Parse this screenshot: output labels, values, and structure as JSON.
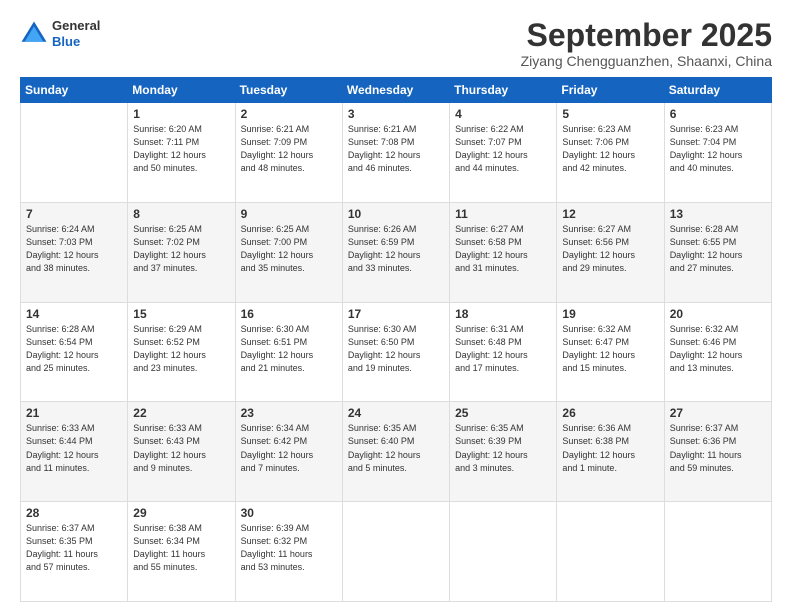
{
  "header": {
    "logo_line1": "General",
    "logo_line2": "Blue",
    "month": "September 2025",
    "location": "Ziyang Chengguanzhen, Shaanxi, China"
  },
  "weekdays": [
    "Sunday",
    "Monday",
    "Tuesday",
    "Wednesday",
    "Thursday",
    "Friday",
    "Saturday"
  ],
  "weeks": [
    [
      {
        "day": "",
        "info": ""
      },
      {
        "day": "1",
        "info": "Sunrise: 6:20 AM\nSunset: 7:11 PM\nDaylight: 12 hours\nand 50 minutes."
      },
      {
        "day": "2",
        "info": "Sunrise: 6:21 AM\nSunset: 7:09 PM\nDaylight: 12 hours\nand 48 minutes."
      },
      {
        "day": "3",
        "info": "Sunrise: 6:21 AM\nSunset: 7:08 PM\nDaylight: 12 hours\nand 46 minutes."
      },
      {
        "day": "4",
        "info": "Sunrise: 6:22 AM\nSunset: 7:07 PM\nDaylight: 12 hours\nand 44 minutes."
      },
      {
        "day": "5",
        "info": "Sunrise: 6:23 AM\nSunset: 7:06 PM\nDaylight: 12 hours\nand 42 minutes."
      },
      {
        "day": "6",
        "info": "Sunrise: 6:23 AM\nSunset: 7:04 PM\nDaylight: 12 hours\nand 40 minutes."
      }
    ],
    [
      {
        "day": "7",
        "info": "Sunrise: 6:24 AM\nSunset: 7:03 PM\nDaylight: 12 hours\nand 38 minutes."
      },
      {
        "day": "8",
        "info": "Sunrise: 6:25 AM\nSunset: 7:02 PM\nDaylight: 12 hours\nand 37 minutes."
      },
      {
        "day": "9",
        "info": "Sunrise: 6:25 AM\nSunset: 7:00 PM\nDaylight: 12 hours\nand 35 minutes."
      },
      {
        "day": "10",
        "info": "Sunrise: 6:26 AM\nSunset: 6:59 PM\nDaylight: 12 hours\nand 33 minutes."
      },
      {
        "day": "11",
        "info": "Sunrise: 6:27 AM\nSunset: 6:58 PM\nDaylight: 12 hours\nand 31 minutes."
      },
      {
        "day": "12",
        "info": "Sunrise: 6:27 AM\nSunset: 6:56 PM\nDaylight: 12 hours\nand 29 minutes."
      },
      {
        "day": "13",
        "info": "Sunrise: 6:28 AM\nSunset: 6:55 PM\nDaylight: 12 hours\nand 27 minutes."
      }
    ],
    [
      {
        "day": "14",
        "info": "Sunrise: 6:28 AM\nSunset: 6:54 PM\nDaylight: 12 hours\nand 25 minutes."
      },
      {
        "day": "15",
        "info": "Sunrise: 6:29 AM\nSunset: 6:52 PM\nDaylight: 12 hours\nand 23 minutes."
      },
      {
        "day": "16",
        "info": "Sunrise: 6:30 AM\nSunset: 6:51 PM\nDaylight: 12 hours\nand 21 minutes."
      },
      {
        "day": "17",
        "info": "Sunrise: 6:30 AM\nSunset: 6:50 PM\nDaylight: 12 hours\nand 19 minutes."
      },
      {
        "day": "18",
        "info": "Sunrise: 6:31 AM\nSunset: 6:48 PM\nDaylight: 12 hours\nand 17 minutes."
      },
      {
        "day": "19",
        "info": "Sunrise: 6:32 AM\nSunset: 6:47 PM\nDaylight: 12 hours\nand 15 minutes."
      },
      {
        "day": "20",
        "info": "Sunrise: 6:32 AM\nSunset: 6:46 PM\nDaylight: 12 hours\nand 13 minutes."
      }
    ],
    [
      {
        "day": "21",
        "info": "Sunrise: 6:33 AM\nSunset: 6:44 PM\nDaylight: 12 hours\nand 11 minutes."
      },
      {
        "day": "22",
        "info": "Sunrise: 6:33 AM\nSunset: 6:43 PM\nDaylight: 12 hours\nand 9 minutes."
      },
      {
        "day": "23",
        "info": "Sunrise: 6:34 AM\nSunset: 6:42 PM\nDaylight: 12 hours\nand 7 minutes."
      },
      {
        "day": "24",
        "info": "Sunrise: 6:35 AM\nSunset: 6:40 PM\nDaylight: 12 hours\nand 5 minutes."
      },
      {
        "day": "25",
        "info": "Sunrise: 6:35 AM\nSunset: 6:39 PM\nDaylight: 12 hours\nand 3 minutes."
      },
      {
        "day": "26",
        "info": "Sunrise: 6:36 AM\nSunset: 6:38 PM\nDaylight: 12 hours\nand 1 minute."
      },
      {
        "day": "27",
        "info": "Sunrise: 6:37 AM\nSunset: 6:36 PM\nDaylight: 11 hours\nand 59 minutes."
      }
    ],
    [
      {
        "day": "28",
        "info": "Sunrise: 6:37 AM\nSunset: 6:35 PM\nDaylight: 11 hours\nand 57 minutes."
      },
      {
        "day": "29",
        "info": "Sunrise: 6:38 AM\nSunset: 6:34 PM\nDaylight: 11 hours\nand 55 minutes."
      },
      {
        "day": "30",
        "info": "Sunrise: 6:39 AM\nSunset: 6:32 PM\nDaylight: 11 hours\nand 53 minutes."
      },
      {
        "day": "",
        "info": ""
      },
      {
        "day": "",
        "info": ""
      },
      {
        "day": "",
        "info": ""
      },
      {
        "day": "",
        "info": ""
      }
    ]
  ]
}
